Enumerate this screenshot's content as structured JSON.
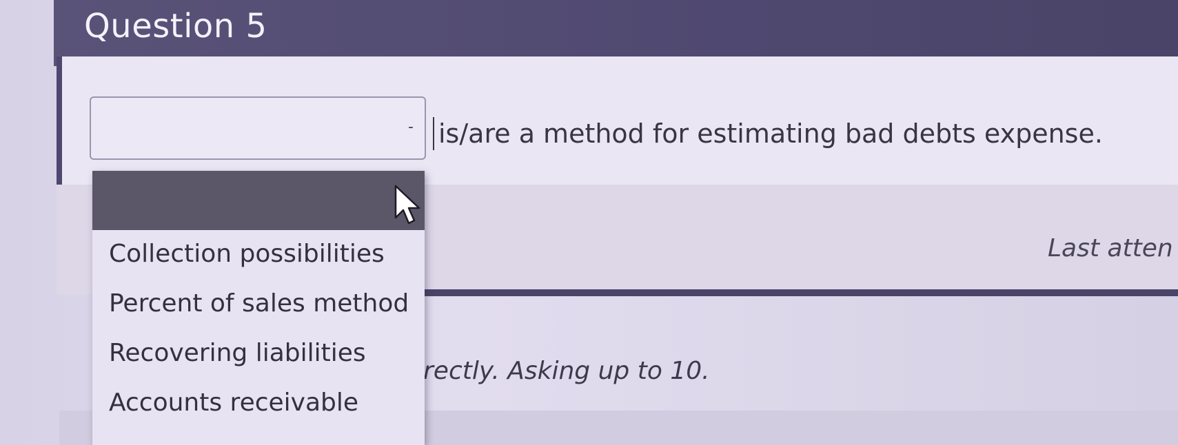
{
  "question": {
    "title": "Question 5",
    "stem": "is/are a method for estimating bad debts expense.",
    "select_value": "",
    "select_arrow": "-"
  },
  "dropdown": {
    "options": [
      "",
      "Collection possibilities",
      "Percent of sales method",
      "Recovering liabilities",
      "Accounts receivable"
    ]
  },
  "status": {
    "last_attempt": "Last atten",
    "feedback": "rectly. Asking up to 10."
  },
  "colors": {
    "header": "#4f4870",
    "highlight": "#5b5668",
    "background": "#e2dcef"
  },
  "icons": {
    "cursor": "mouse-pointer-icon",
    "arrow": "chevron-down-icon"
  }
}
